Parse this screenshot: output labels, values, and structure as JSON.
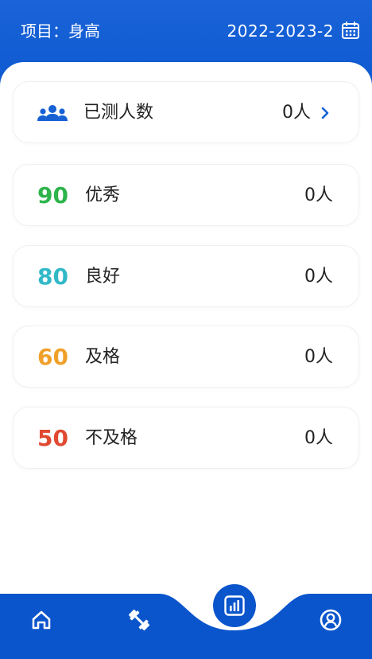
{
  "header": {
    "title": "项目：身高",
    "term": "2022-2023-2",
    "calendar_icon": "calendar-icon",
    "background": "#0d59cf"
  },
  "summary": {
    "icon": "people-icon",
    "label": "已测人数",
    "count": "0人",
    "chevron": "chevron-right-icon"
  },
  "grades": [
    {
      "score": "90",
      "label": "优秀",
      "count": "0人",
      "color": "#2db44a"
    },
    {
      "score": "80",
      "label": "良好",
      "count": "0人",
      "color": "#32b9c8"
    },
    {
      "score": "60",
      "label": "及格",
      "count": "0人",
      "color": "#f0a02a"
    },
    {
      "score": "50",
      "label": "不及格",
      "count": "0人",
      "color": "#e04a32"
    }
  ],
  "bottom_nav": {
    "items": [
      "home-icon",
      "dumbbell-icon",
      "chart-icon",
      "user-icon"
    ],
    "color": "#0b55cc"
  }
}
